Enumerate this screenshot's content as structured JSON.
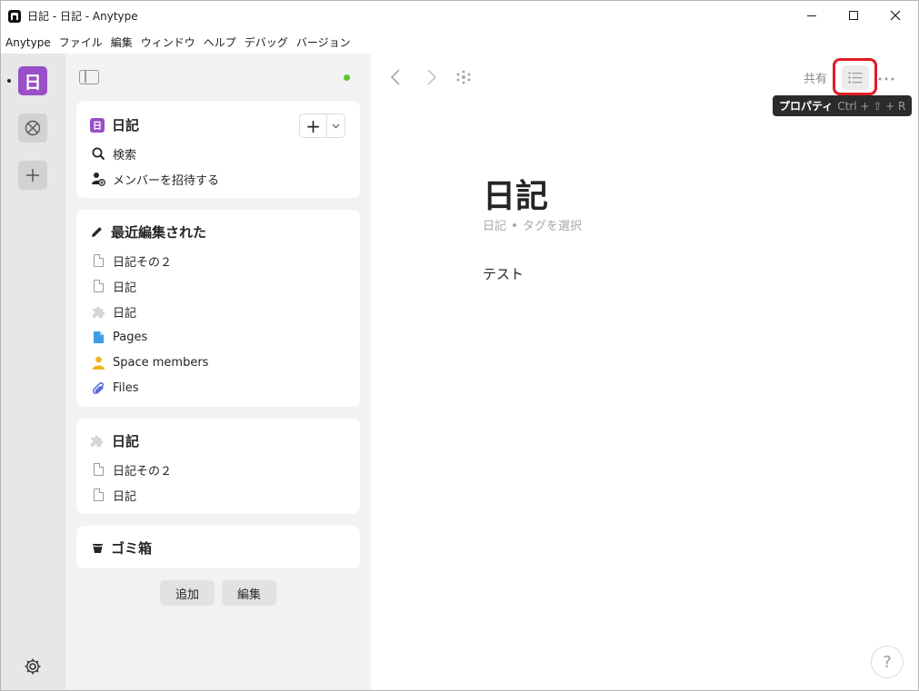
{
  "window": {
    "title": "日記 - 日記 - Anytype"
  },
  "menu": [
    "Anytype",
    "ファイル",
    "編集",
    "ウィンドウ",
    "ヘルプ",
    "デバッグ",
    "バージョン"
  ],
  "rail": {
    "space_initial": "日"
  },
  "space_card": {
    "name": "日記",
    "badge": "日",
    "search_label": "検索",
    "invite_label": "メンバーを招待する"
  },
  "recent": {
    "title": "最近編集された",
    "items": [
      {
        "label": "日記その２",
        "icon": "document-icon"
      },
      {
        "label": "日記",
        "icon": "document-icon"
      },
      {
        "label": "日記",
        "icon": "puzzle-icon"
      },
      {
        "label": "Pages",
        "icon": "page-blue-icon"
      },
      {
        "label": "Space members",
        "icon": "person-icon"
      },
      {
        "label": "Files",
        "icon": "paperclip-icon"
      }
    ]
  },
  "widget": {
    "title": "日記",
    "items": [
      {
        "label": "日記その２"
      },
      {
        "label": "日記"
      }
    ]
  },
  "trash": {
    "title": "ゴミ箱"
  },
  "sidebar_buttons": {
    "add": "追加",
    "edit": "編集"
  },
  "header": {
    "share": "共有",
    "tooltip_name": "プロパティ",
    "tooltip_shortcut": "Ctrl + ⇧ + R"
  },
  "page": {
    "title": "日記",
    "type": "日記",
    "tag_placeholder": "タグを選択",
    "body": "テスト"
  },
  "help": "?",
  "colors": {
    "accent_purple": "#9a4fc7",
    "online": "#5cc72c",
    "highlight_red": "#e01b24"
  }
}
